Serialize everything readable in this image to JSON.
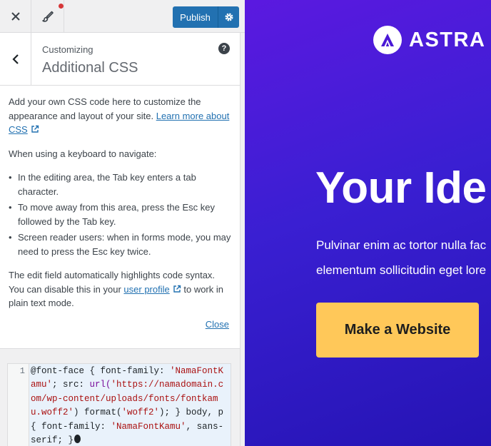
{
  "topbar": {
    "publish_label": "Publish"
  },
  "section": {
    "breadcrumb": "Customizing",
    "title": "Additional CSS",
    "help_glyph": "?"
  },
  "description": {
    "intro": "Add your own CSS code here to customize the appearance and layout of your site.",
    "learn_more": "Learn more about CSS",
    "keyboard_heading": "When using a keyboard to navigate:",
    "bullets": [
      "In the editing area, the Tab key enters a tab character.",
      "To move away from this area, press the Esc key followed by the Tab key.",
      "Screen reader users: when in forms mode, you may need to press the Esc key twice."
    ],
    "highlight_prefix": "The edit field automatically highlights code syntax. You can disable this in your",
    "user_profile_link": "user profile",
    "highlight_suffix": "to work in plain text mode.",
    "close_label": "Close"
  },
  "editor": {
    "line_number": "1",
    "tokens": {
      "at_rule": "@font-face",
      "t1": " { font-family: ",
      "s1": "'NamaFontKamu'",
      "t2": "; src: ",
      "url_fn": "url(",
      "s2": "'https://namadomain.com/wp-content/uploads/fonts/fontkamu.woff2'",
      "t3": ") format(",
      "s3": "'woff2'",
      "t4": "); } body, p { font-family: ",
      "s4": "'NamaFontKamu'",
      "t5": ", sans-serif; }"
    }
  },
  "preview": {
    "logo_text": "ASTRA",
    "hero_heading": "Your Ide",
    "hero_line_1": "Pulvinar enim ac tortor nulla fac",
    "hero_line_2": "elementum sollicitudin eget lore",
    "cta_label": "Make a Website"
  },
  "colors": {
    "accent": "#2271b1",
    "notice_dot": "#d63638",
    "preview_bg_start": "#5b19e0",
    "preview_bg_end": "#2514b4",
    "cta": "#ffc859"
  },
  "icons": [
    "close-icon",
    "brush-icon",
    "gear-icon",
    "chevron-left-icon",
    "help-icon",
    "external-link-icon",
    "astra-logo-icon"
  ]
}
